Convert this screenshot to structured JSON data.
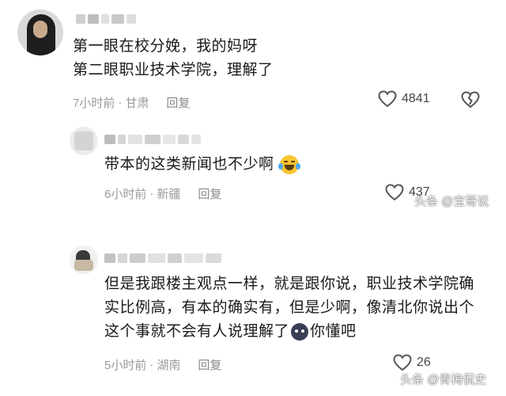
{
  "comments": [
    {
      "lines": [
        "第一眼在校分娩，我的妈呀",
        "第二眼职业技术学院，理解了"
      ],
      "time": "7小时前",
      "location": "甘肃",
      "reply_label": "回复",
      "likes": "4841"
    },
    {
      "lines": [
        "带本的这类新闻也不少啊"
      ],
      "time": "6小时前",
      "location": "新疆",
      "reply_label": "回复",
      "likes": "437"
    },
    {
      "lines": [
        "但是我跟楼主观点一样，就是跟你说，职业技术学院确",
        "实比例高，有本的确实有，但是少啊，像清北你说出个",
        "这个事就不会有人说理解了"
      ],
      "line3_suffix": "你懂吧",
      "time": "5小时前",
      "location": "湖南",
      "reply_label": "回复",
      "likes": "26"
    }
  ],
  "watermarks": [
    "头条 @宝哥说",
    "头条 @青梅侃史"
  ],
  "icons": [
    "heart-outline-icon",
    "broken-heart-icon",
    "laughing-tears-emoji",
    "dark-face-emoji"
  ],
  "colors": {
    "meta": "#9a9a9a",
    "text": "#1a1a1a",
    "icon": "#555555"
  }
}
